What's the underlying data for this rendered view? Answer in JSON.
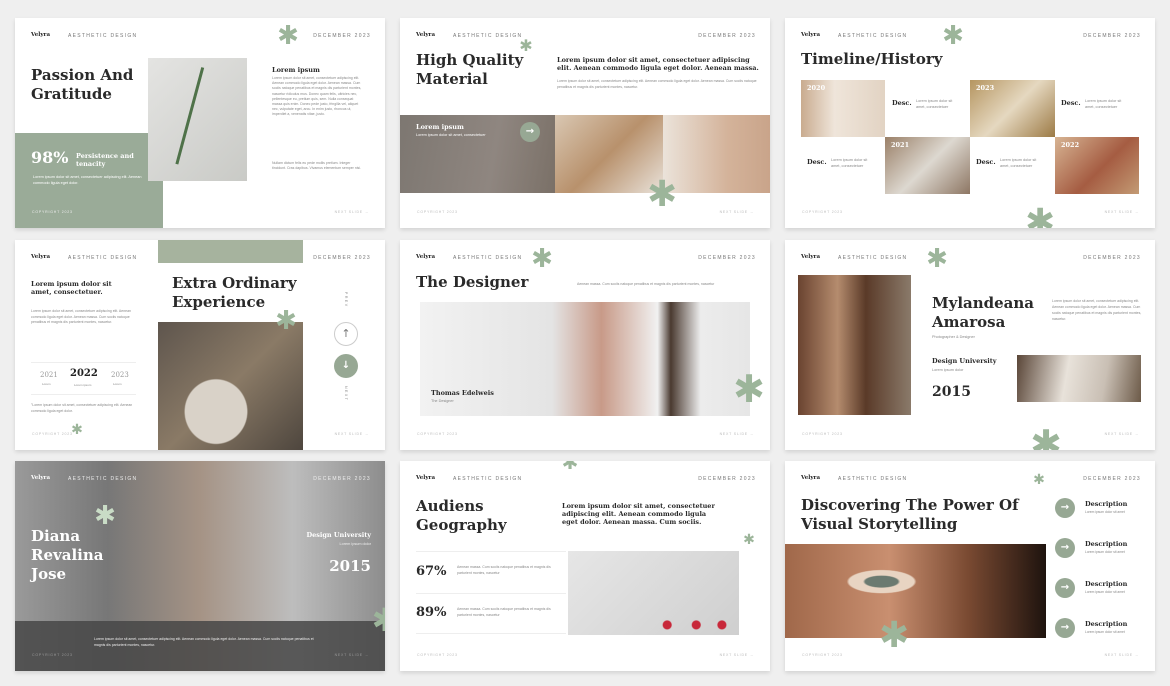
{
  "common": {
    "brand": "Velyra",
    "tag": "AESTHETIC DESIGN",
    "date": "DECEMBER 2023",
    "footer_left": "COPYRIGHT 2023",
    "footer_right": "NEXT SLIDE →",
    "lorem_short": "Lorem ipsum dolor sit amet, consectetuer",
    "lorem_tiny": "Lorem ipsum dolor",
    "lorem_long": "Lorem ipsum dolor sit amet, consectetuer adipiscing elit. Aenean commodo ligula eget dolor. Aenean massa. Cum sociis natoque penatibus et magnis dis parturient montes, nascetur ridiculus mus. Donec quam felis, ultricies nec, pellentesque eu, pretium quis, sem. Nulla consequat massa quis enim. Donec pede justo, fringilla vel, aliquet nec, vulputate eget, arcu. In enim justo, rhoncus ut, imperdiet a, venenatis vitae, justo.",
    "lorem_mid": "Lorem ipsum dolor sit amet, consectetuer adipiscing elit. Aenean commodo ligula eget dolor. Aenean massa. Cum sociis natoque penatibus et magnis dis parturient montes, nascetur.",
    "aenean": "Aenean massa. Cum sociis natoque penatibus et magnis dis parturient montes, nascetur",
    "accent": "#97a894"
  },
  "s1": {
    "title": "Passion And Gratitude",
    "stat": "98%",
    "stat_label": "Persistence and tenacity",
    "stat_text": "Lorem ipsum dolor sit amet, consectetuer adipiscing elit. Aenean commodo ligula eget dolor.",
    "heading": "Lorem ipsum",
    "body2": "Nullam dictum felis eu pede mollis pretium. Integer tincidunt. Cras dapibus. Vivamus elementum semper nisi."
  },
  "s2": {
    "title": "High Quality Material",
    "heading": "Lorem ipsum dolor sit amet, consectetuer adipiscing elit. Aenean commodo ligula eget dolor. Aenean massa.",
    "card_title": "Lorem ipsum"
  },
  "s3": {
    "title": "Timeline/History",
    "years": [
      "2020",
      "2023",
      "2021",
      "2022"
    ],
    "desc": "Desc."
  },
  "s4": {
    "heading": "Lorem ipsum dolor sit amet, consectetuer.",
    "title": "Extra Ordinary Experience",
    "years": [
      "2021",
      "2022",
      "2023"
    ],
    "year_sub": [
      "Lorem",
      "Lorem ipsum",
      "Lorem"
    ],
    "quote": "\"Lorem ipsum dolor sit amet, consectetuer adipiscing elit. Aenean commodo ligula eget dolor.",
    "prev": "PREV",
    "next": "NEXT"
  },
  "s5": {
    "title": "The Designer",
    "name": "Thomas Edelweis",
    "role": "The Designer"
  },
  "s6": {
    "name": "Mylandeana Amarosa",
    "role": "Photographer & Designer",
    "school": "Design University",
    "year": "2015"
  },
  "s7": {
    "name": "Diana Revalina Jose",
    "school": "Design University",
    "year": "2015"
  },
  "s8": {
    "title": "Audiens Geography",
    "heading": "Lorem ipsum dolor sit amet, consectetuer adipiscing elit. Aenean commodo ligula eget dolor. Aenean massa. Cum sociis.",
    "stats": [
      "67%",
      "89%"
    ]
  },
  "s9": {
    "title": "Discovering The Power Of Visual Storytelling",
    "item": "Description",
    "item_text": "Lorem ipsum dolor sit amet"
  }
}
